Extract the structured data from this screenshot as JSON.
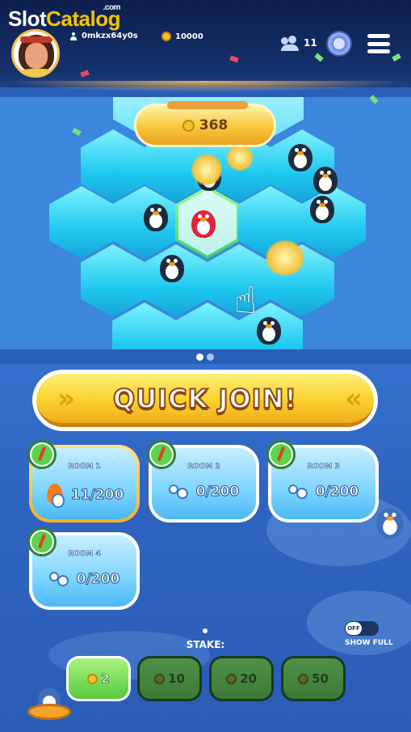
{
  "watermark": {
    "brand_part1": "Slot",
    "brand_part2": "Catalog",
    "brand_suffix": ".com"
  },
  "header": {
    "username": "0mkzx64y0s",
    "balance": "10000",
    "players_online": "11",
    "icons": {
      "user": "user-icon",
      "coin": "coin-icon",
      "players": "players-icon",
      "badge": "rank-badge-icon",
      "menu": "hamburger-menu-icon"
    }
  },
  "preview": {
    "counter_value": "368",
    "carousel_pages": 2,
    "carousel_active_page": 1
  },
  "quick_join": {
    "label": "QUICK JOIN!"
  },
  "rooms": [
    {
      "name": "ROOM 1",
      "players": "11/200",
      "hot": true
    },
    {
      "name": "ROOM 2",
      "players": "0/200",
      "hot": false
    },
    {
      "name": "ROOM 3",
      "players": "0/200",
      "hot": false
    },
    {
      "name": "ROOM 4",
      "players": "0/200",
      "hot": false
    }
  ],
  "show_full": {
    "toggle_state": "OFF",
    "label": "SHOW FULL"
  },
  "stake": {
    "label": "STAKE:",
    "options": [
      "2",
      "10",
      "20",
      "50"
    ],
    "selected": "2"
  },
  "colors": {
    "accent_yellow": "#fbd431",
    "room_blue": "#7ed5ff",
    "stake_green": "#56c93c",
    "background_blue": "#2e64c0"
  }
}
